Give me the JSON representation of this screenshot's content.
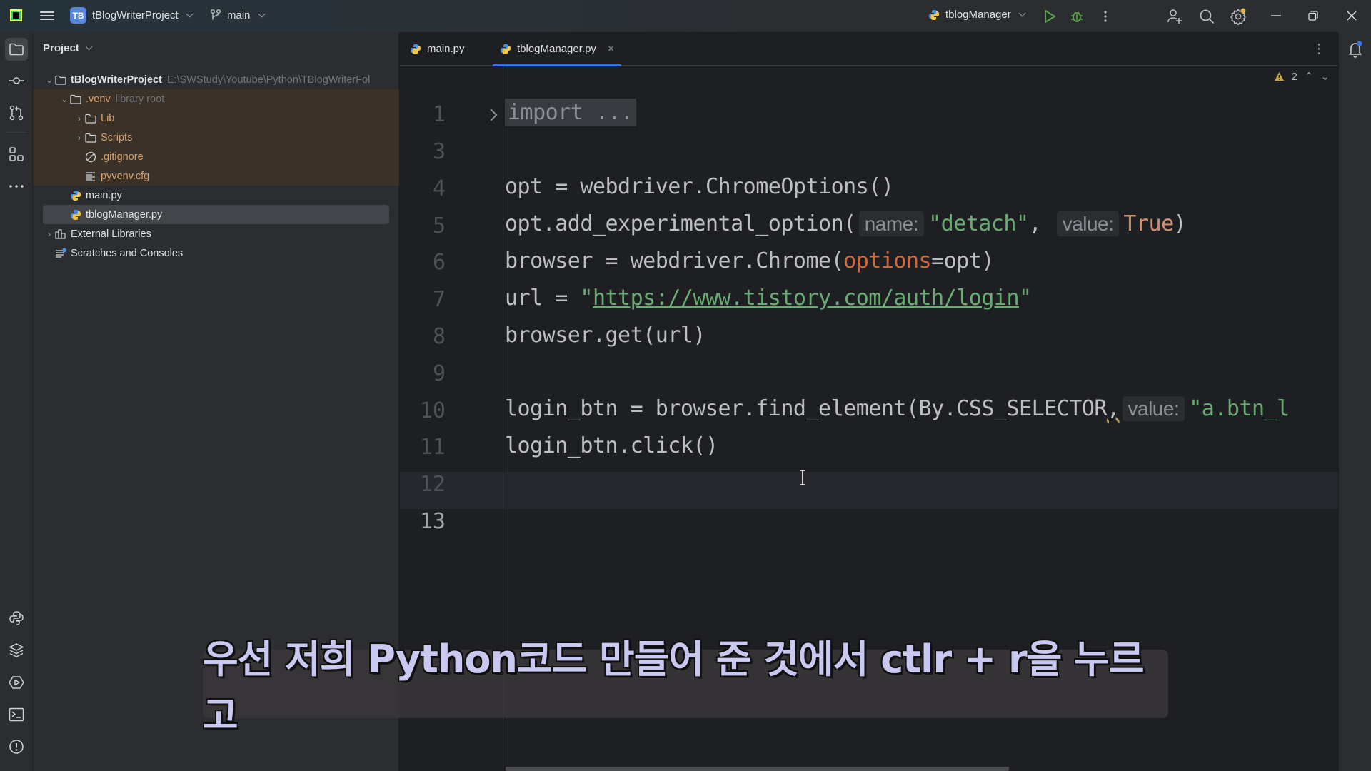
{
  "titlebar": {
    "project_badge": "TB",
    "project_name": "tBlogWriterProject",
    "branch": "main",
    "run_config": "tblogManager",
    "icons": [
      "app-logo-icon",
      "hamburger-menu-icon",
      "branch-icon",
      "python-icon",
      "run-icon",
      "debug-icon",
      "more-vertical-icon",
      "add-user-icon",
      "search-icon",
      "settings-icon",
      "minimize-icon",
      "restore-icon",
      "close-icon"
    ]
  },
  "left_strip": {
    "top_icons": [
      "project-folder-icon",
      "commit-icon",
      "pull-requests-icon",
      "structure-icon",
      "more-tools-icon"
    ],
    "bottom_icons": [
      "python-console-icon",
      "python-packages-icon",
      "services-icon",
      "terminal-icon",
      "problems-icon"
    ]
  },
  "project_panel": {
    "title": "Project",
    "tree": [
      {
        "label": "tBlogWriterProject",
        "hint": "E:\\SWStudy\\Youtube\\Python\\TBlogWriterFol",
        "expanded": true,
        "icon": "folder"
      },
      {
        "label": ".venv",
        "hint": "library root",
        "expanded": true,
        "icon": "folder"
      },
      {
        "label": "Lib",
        "expanded": false,
        "icon": "folder"
      },
      {
        "label": "Scripts",
        "expanded": false,
        "icon": "folder"
      },
      {
        "label": ".gitignore",
        "icon": "ignore-file"
      },
      {
        "label": "pyvenv.cfg",
        "icon": "text-file"
      },
      {
        "label": "main.py",
        "icon": "python"
      },
      {
        "label": "tblogManager.py",
        "icon": "python",
        "selected": true
      },
      {
        "label": "External Libraries",
        "expanded": false,
        "icon": "library"
      },
      {
        "label": "Scratches and Consoles",
        "icon": "scratches"
      }
    ]
  },
  "editor": {
    "tabs": [
      {
        "label": "main.py",
        "active": false
      },
      {
        "label": "tblogManager.py",
        "active": true
      }
    ],
    "inspections": {
      "warnings": "2"
    },
    "line_numbers": [
      "1",
      "3",
      "4",
      "5",
      "6",
      "7",
      "8",
      "9",
      "10",
      "11",
      "12",
      "13"
    ],
    "code": {
      "l1": "import ...",
      "l4": "opt = webdriver.ChromeOptions()",
      "l5_pre": "opt.add_experimental_option(",
      "l5_hint1": "name:",
      "l5_str": "\"detach\"",
      "l5_mid": ", ",
      "l5_hint2": "value:",
      "l5_kw": "True",
      "l5_post": ")",
      "l6_pre": "browser = webdriver.Chrome(",
      "l6_param": "options",
      "l6_post": "=opt)",
      "l7_pre": "url = ",
      "l7_q1": "\"",
      "l7_url": "https://www.tistory.com/auth/login",
      "l7_q2": "\"",
      "l8": "browser.get(url)",
      "l10_pre": "login_btn = browser.find_element(By.CSS_SELECTOR",
      "l10_comma": ",",
      "l10_hint": "value:",
      "l10_str": "\"a.btn_l",
      "l11": "login_btn.click()"
    }
  },
  "subtitle": "우선 저희 Python코드 만들어 준 것에서 ctlr + r을 누르고",
  "colors": {
    "accent": "#3574f0",
    "string": "#6aab73",
    "keyword": "#cf8e6d",
    "param": "#d0683d",
    "excluded_bg": "#3a3129"
  }
}
